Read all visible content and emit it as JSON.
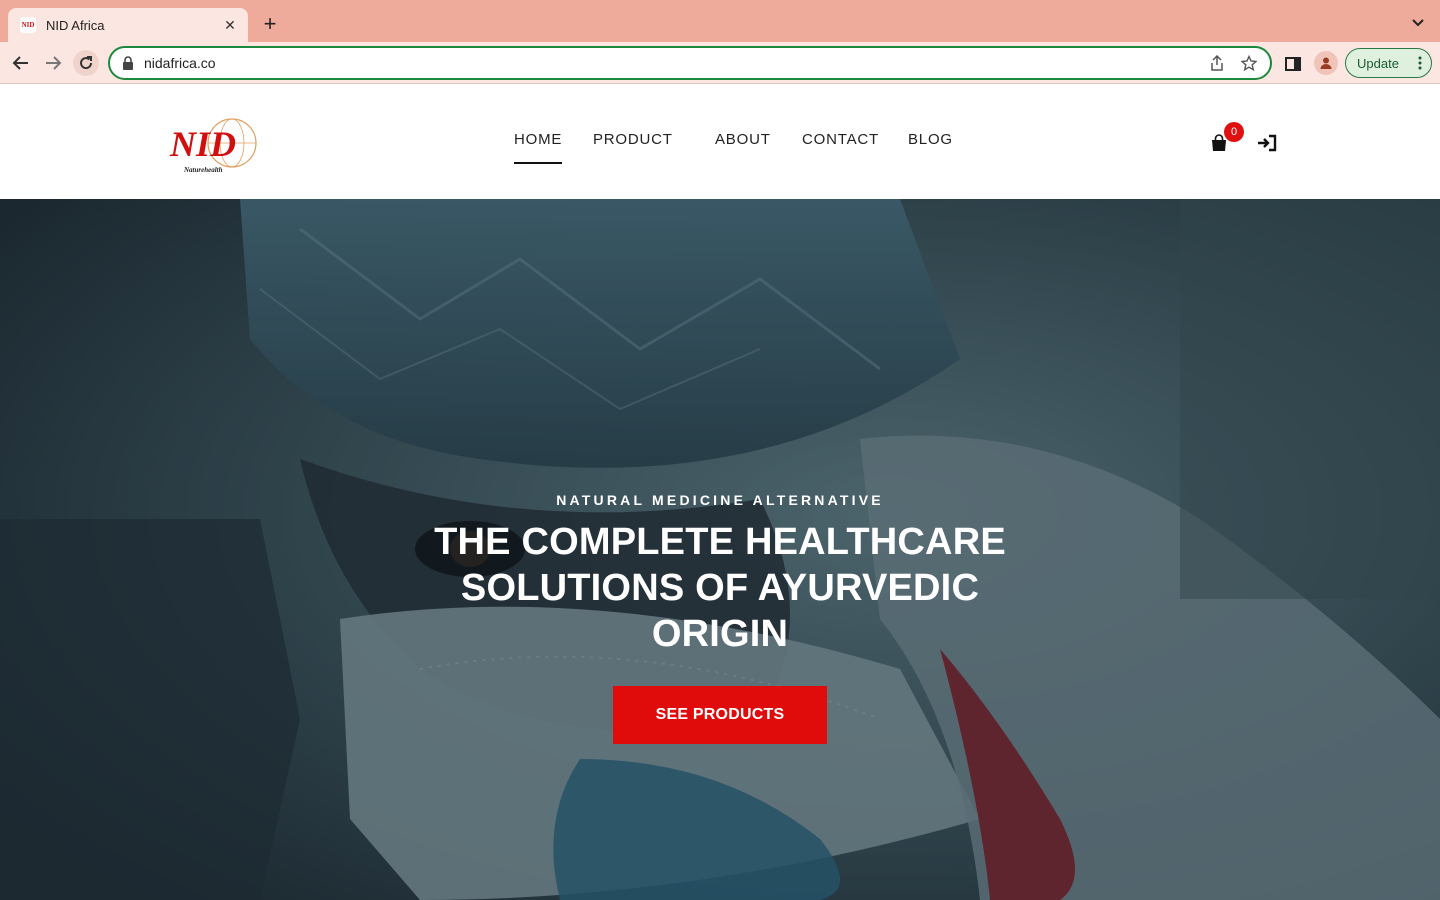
{
  "browser": {
    "tab_title": "NID Africa",
    "favicon_text": "NID",
    "url": "nidafrica.co",
    "update_label": "Update"
  },
  "site": {
    "logo_text": "NID",
    "logo_tagline": "Naturehealth",
    "nav": [
      {
        "label": "HOME",
        "active": true
      },
      {
        "label": "PRODUCT",
        "active": false
      },
      {
        "label": "ABOUT",
        "active": false
      },
      {
        "label": "CONTACT",
        "active": false
      },
      {
        "label": "BLOG",
        "active": false
      }
    ],
    "cart_count": "0"
  },
  "hero": {
    "eyebrow": "NATURAL MEDICINE ALTERNATIVE",
    "title": "THE COMPLETE HEALTHCARE SOLUTIONS OF AYURVEDIC ORIGIN",
    "cta_label": "SEE PRODUCTS"
  },
  "colors": {
    "tab_strip": "#eeaa9a",
    "brand_red": "#e00b0b",
    "omnibox_focus": "#1c8a3c"
  },
  "icons": {
    "back": "arrow-left-icon",
    "forward": "arrow-right-icon",
    "reload": "reload-icon",
    "lock": "lock-icon",
    "share": "share-icon",
    "bookmark": "star-icon",
    "side_panel": "side-panel-icon",
    "profile": "avatar-icon",
    "cart": "shopping-bag-icon",
    "login": "sign-in-icon"
  }
}
